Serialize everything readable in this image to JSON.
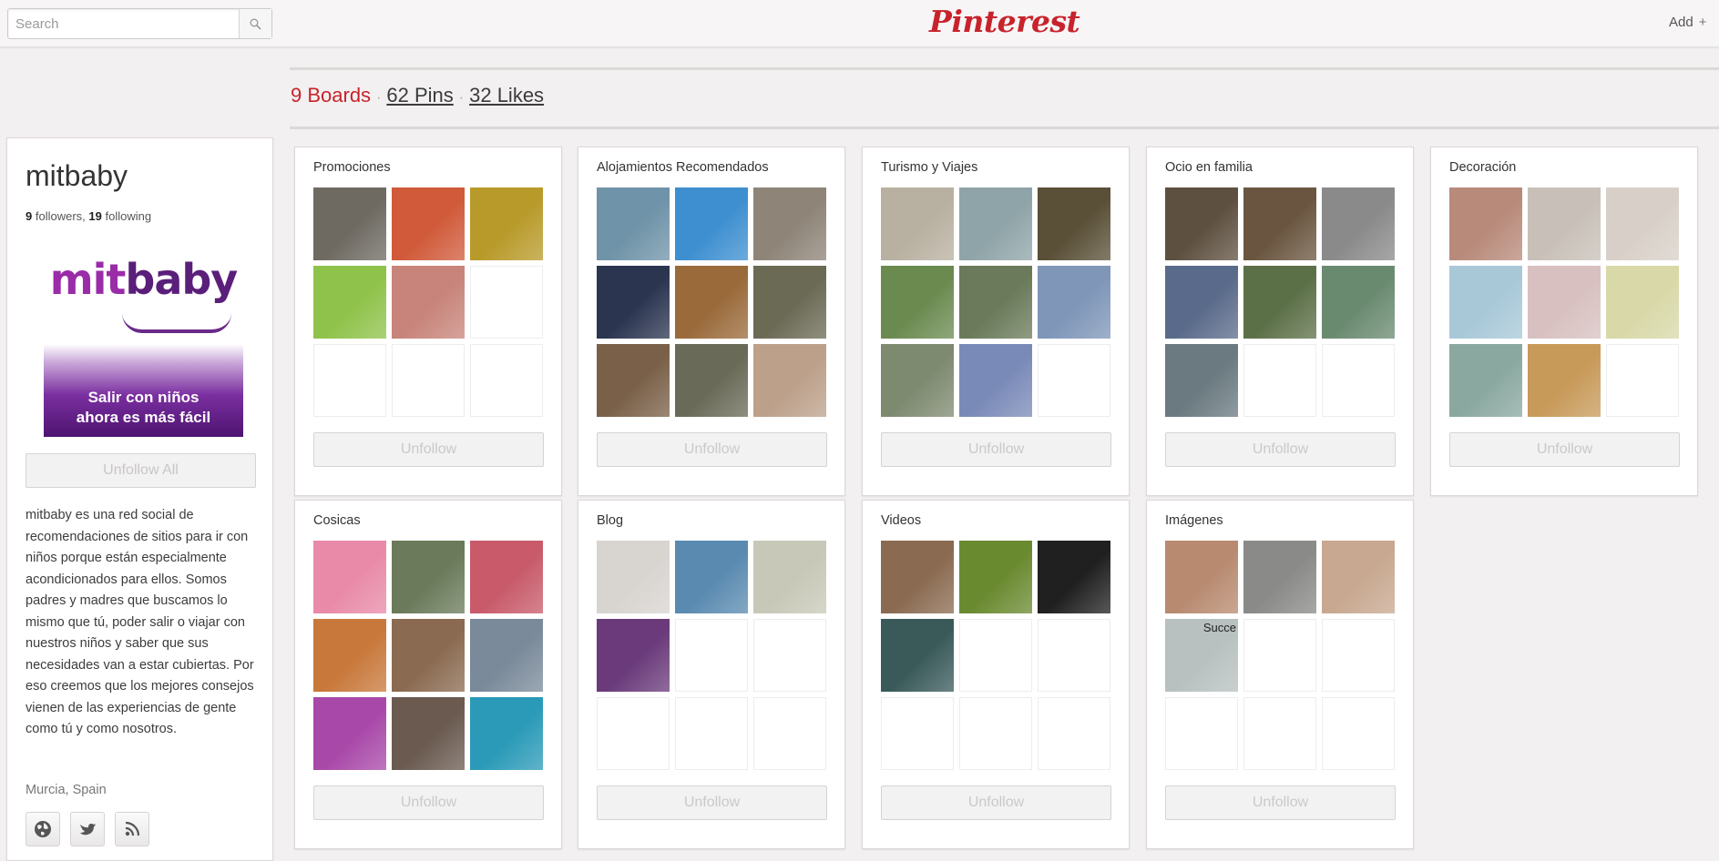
{
  "header": {
    "search_placeholder": "Search",
    "logo_text": "Pinterest",
    "add_label": "Add",
    "add_icon": "+"
  },
  "stats": {
    "boards": "9 Boards",
    "pins": "62 Pins",
    "likes": "32 Likes",
    "separator": "·"
  },
  "profile": {
    "name": "mitbaby",
    "followers_count": "9",
    "followers_label": "followers,",
    "following_count": "19",
    "following_label": "following",
    "avatar_brand_a": "mit",
    "avatar_brand_b": "baby",
    "avatar_banner_line1": "Salir con niños",
    "avatar_banner_line2": "ahora es más fácil",
    "unfollow_all_label": "Unfollow All",
    "bio": "mitbaby es una red social de recomendaciones de sitios para ir con niños porque están especialmente acondicionados para ellos. Somos padres y madres que buscamos lo mismo que tú, poder salir o viajar con nuestros niños y saber que sus necesidades van a estar cubiertas. Por eso creemos que los mejores consejos vienen de las experiencias de gente como tú y como nosotros.",
    "location": "Murcia, Spain",
    "social_icons": [
      "globe-icon",
      "twitter-icon",
      "rss-icon"
    ]
  },
  "colors": {
    "brand_red": "#c8232c",
    "avatar_purple": "#6b2a8a"
  },
  "boards": [
    {
      "title": "Promociones",
      "button": "Unfollow",
      "thumbs": [
        "#6e6a62",
        "#d05a3a",
        "#b89a2a",
        "#8fc24a",
        "#c8847a",
        "",
        "",
        "",
        ""
      ]
    },
    {
      "title": "Alojamientos Recomendados",
      "button": "Unfollow",
      "thumbs": [
        "#6f93a8",
        "#3d8fd0",
        "#8e8478",
        "#2b3550",
        "#9a6a3a",
        "#6b6a55",
        "#7a6048",
        "#6a6a58",
        "#bca08a"
      ]
    },
    {
      "title": "Turismo y Viajes",
      "button": "Unfollow",
      "thumbs": [
        "#b8b0a0",
        "#8fa4a8",
        "#5a5038",
        "#6a8a50",
        "#6a7a5a",
        "#7f96b8",
        "#7e8a70",
        "#7a8ab8",
        ""
      ]
    },
    {
      "title": "Ocio en familia",
      "button": "Unfollow",
      "thumbs": [
        "#5e5040",
        "#6a5640",
        "#8a8a8a",
        "#5a6a8a",
        "#5c7048",
        "#6a8a70",
        "#6a7a80",
        "",
        ""
      ]
    },
    {
      "title": "Decoración",
      "button": "Unfollow",
      "thumbs": [
        "#b88a7a",
        "#c8c0b8",
        "#d8d0c8",
        "#a8c8d8",
        "#d8c0c0",
        "#d8d8a8",
        "#8aa8a0",
        "#c89a5a",
        ""
      ]
    },
    {
      "title": "Cosicas",
      "button": "Unfollow",
      "thumbs": [
        "#e88aa8",
        "#6a7a5a",
        "#c85a6a",
        "#c8783a",
        "#8a6a50",
        "#7a8a9a",
        "#a848a8",
        "#6a5a50",
        "#2a9ab8"
      ]
    },
    {
      "title": "Blog",
      "button": "Unfollow",
      "thumbs": [
        "#d8d4d0",
        "#5a8ab0",
        "#c8c8b8",
        "#6a3a7a",
        "",
        "",
        "",
        "",
        ""
      ]
    },
    {
      "title": "Videos",
      "button": "Unfollow",
      "thumbs": [
        "#8a6a50",
        "#6a8a30",
        "#202020",
        "#3a5a5a",
        "",
        "",
        "",
        "",
        ""
      ]
    },
    {
      "title": "Imágenes",
      "button": "Unfollow",
      "thumbs": [
        "#b88a70",
        "#8a8a88",
        "#c8a890",
        "#b8c0c0",
        "",
        "",
        "",
        "",
        ""
      ],
      "caption": "Succe"
    }
  ]
}
